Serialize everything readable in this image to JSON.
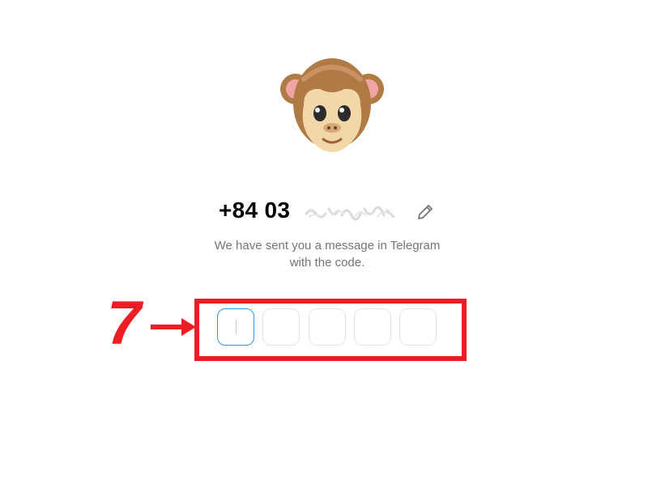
{
  "auth": {
    "phone_number": "+84 03",
    "subtitle_line1": "We have sent you a message in Telegram",
    "subtitle_line2": "with the code.",
    "edit_icon": "pencil-icon",
    "avatar_icon": "monkey-face-icon",
    "code_length": 5,
    "active_code_index": 0
  },
  "annotation": {
    "step_number": "7",
    "arrow_icon": "right-arrow-icon",
    "color": "#ee1c25"
  },
  "colors": {
    "accent": "#3390ec",
    "subtitle": "#707579",
    "box_border": "#dfe1e5",
    "annotation": "#ee1c25"
  }
}
